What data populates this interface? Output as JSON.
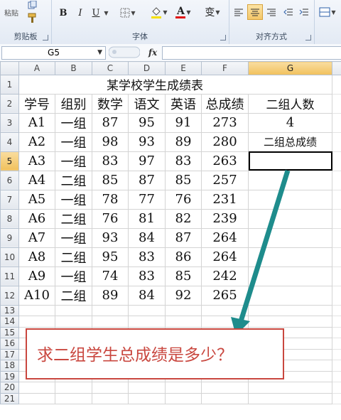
{
  "ribbon": {
    "paste_label": "粘贴",
    "clipboard_label": "剪贴板",
    "font_group_label": "字体",
    "align_group_label": "对齐方式",
    "bold": "B",
    "italic": "I",
    "underline": "U",
    "font_color_letter": "A",
    "wen": "变"
  },
  "formula_bar": {
    "name_box": "G5",
    "fx_label": "fx",
    "content": ""
  },
  "columns": [
    "A",
    "B",
    "C",
    "D",
    "E",
    "F",
    "G"
  ],
  "rows": [
    {
      "n": "1",
      "cells": [
        "",
        "",
        "",
        "",
        "",
        "",
        ""
      ],
      "title": "某学校学生成绩表"
    },
    {
      "n": "2",
      "cells": [
        "学号",
        "组别",
        "数学",
        "语文",
        "英语",
        "总成绩",
        "二组人数"
      ]
    },
    {
      "n": "3",
      "cells": [
        "A1",
        "一组",
        "87",
        "95",
        "91",
        "273",
        "4"
      ]
    },
    {
      "n": "4",
      "cells": [
        "A2",
        "一组",
        "98",
        "93",
        "89",
        "280",
        "二组总成绩"
      ]
    },
    {
      "n": "5",
      "cells": [
        "A3",
        "一组",
        "83",
        "97",
        "83",
        "263",
        ""
      ]
    },
    {
      "n": "6",
      "cells": [
        "A4",
        "二组",
        "85",
        "87",
        "85",
        "257",
        ""
      ]
    },
    {
      "n": "7",
      "cells": [
        "A5",
        "一组",
        "78",
        "77",
        "76",
        "231",
        ""
      ]
    },
    {
      "n": "8",
      "cells": [
        "A6",
        "二组",
        "76",
        "81",
        "82",
        "239",
        ""
      ]
    },
    {
      "n": "9",
      "cells": [
        "A7",
        "一组",
        "93",
        "84",
        "87",
        "264",
        ""
      ]
    },
    {
      "n": "10",
      "cells": [
        "A8",
        "二组",
        "95",
        "83",
        "86",
        "264",
        ""
      ]
    },
    {
      "n": "11",
      "cells": [
        "A9",
        "一组",
        "74",
        "83",
        "85",
        "242",
        ""
      ]
    },
    {
      "n": "12",
      "cells": [
        "A10",
        "二组",
        "89",
        "84",
        "92",
        "265",
        ""
      ]
    },
    {
      "n": "13",
      "cells": [
        "",
        "",
        "",
        "",
        "",
        "",
        ""
      ]
    },
    {
      "n": "14",
      "cells": [
        "",
        "",
        "",
        "",
        "",
        "",
        ""
      ]
    },
    {
      "n": "15",
      "cells": [
        "",
        "",
        "",
        "",
        "",
        "",
        ""
      ]
    },
    {
      "n": "16",
      "cells": [
        "",
        "",
        "",
        "",
        "",
        "",
        ""
      ]
    },
    {
      "n": "17",
      "cells": [
        "",
        "",
        "",
        "",
        "",
        "",
        ""
      ]
    },
    {
      "n": "18",
      "cells": [
        "",
        "",
        "",
        "",
        "",
        "",
        ""
      ]
    },
    {
      "n": "19",
      "cells": [
        "",
        "",
        "",
        "",
        "",
        "",
        ""
      ]
    },
    {
      "n": "20",
      "cells": [
        "",
        "",
        "",
        "",
        "",
        "",
        ""
      ]
    },
    {
      "n": "21",
      "cells": [
        "",
        "",
        "",
        "",
        "",
        "",
        ""
      ]
    }
  ],
  "active_cell": "G5",
  "callout": {
    "text": "求二组学生总成绩是多少？",
    "color": "#c9473f"
  },
  "arrow_color": "#1e8c8c"
}
